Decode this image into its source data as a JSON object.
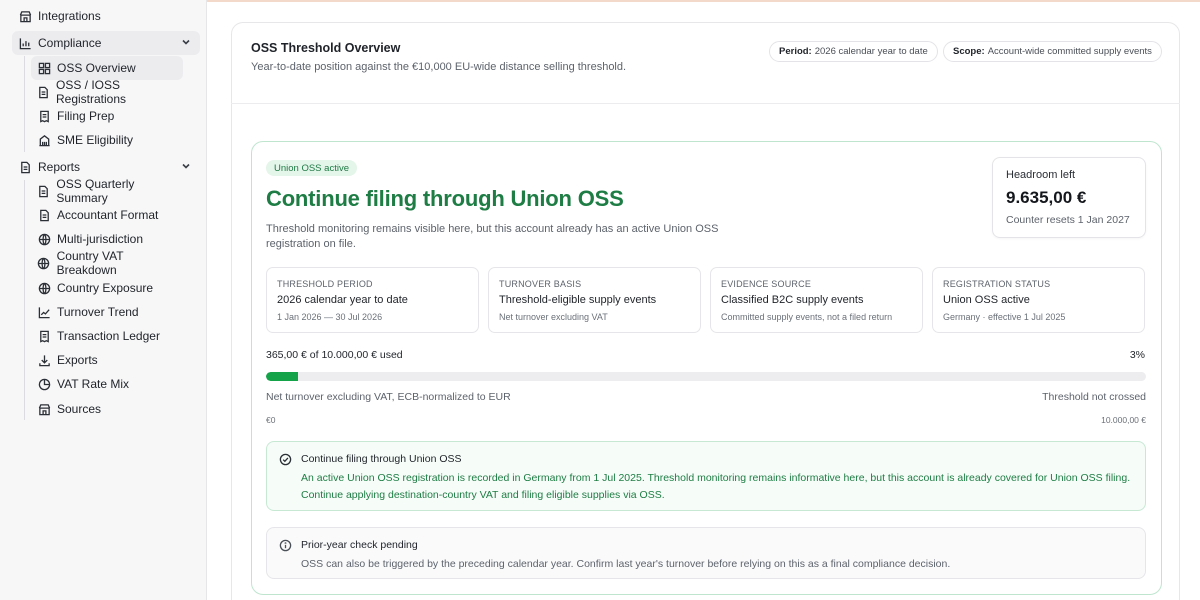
{
  "sidebar": {
    "items": [
      {
        "label": "Integrations",
        "icon": "store-icon"
      },
      {
        "label": "Compliance",
        "icon": "bar-chart-icon",
        "expanded": true
      },
      {
        "label": "OSS Overview",
        "icon": "dashboard-grid-icon",
        "active": true
      },
      {
        "label": "OSS / IOSS Registrations",
        "icon": "document-icon"
      },
      {
        "label": "Filing Prep",
        "icon": "receipt-icon"
      },
      {
        "label": "SME Eligibility",
        "icon": "building-icon"
      },
      {
        "label": "Reports",
        "icon": "document-icon",
        "expanded": true
      },
      {
        "label": "OSS Quarterly Summary",
        "icon": "document-icon"
      },
      {
        "label": "Accountant Format",
        "icon": "document-icon"
      },
      {
        "label": "Multi-jurisdiction",
        "icon": "globe-icon"
      },
      {
        "label": "Country VAT Breakdown",
        "icon": "globe-icon"
      },
      {
        "label": "Country Exposure",
        "icon": "globe-icon"
      },
      {
        "label": "Turnover Trend",
        "icon": "line-chart-icon"
      },
      {
        "label": "Transaction Ledger",
        "icon": "receipt-icon"
      },
      {
        "label": "Exports",
        "icon": "download-icon"
      },
      {
        "label": "VAT Rate Mix",
        "icon": "pie-chart-icon"
      },
      {
        "label": "Sources",
        "icon": "store-icon"
      }
    ]
  },
  "header": {
    "title": "OSS Threshold Overview",
    "subtitle": "Year-to-date position against the €10,000 EU-wide distance selling threshold.",
    "period_label": "Period:",
    "period_value": "2026 calendar year to date",
    "scope_label": "Scope:",
    "scope_value": "Account-wide committed supply events"
  },
  "status": {
    "badge": "Union OSS active",
    "headline": "Continue filing through Union OSS",
    "lead": "Threshold monitoring remains visible here, but this account already has an active Union OSS registration on file."
  },
  "headroom": {
    "label": "Headroom left",
    "value": "9.635,00 €",
    "footnote": "Counter resets 1 Jan 2027"
  },
  "stats": [
    {
      "key": "THRESHOLD PERIOD",
      "value": "2026 calendar year to date",
      "note": "1 Jan 2026 — 30 Jul 2026"
    },
    {
      "key": "TURNOVER BASIS",
      "value": "Threshold-eligible supply events",
      "note": "Net turnover excluding VAT"
    },
    {
      "key": "EVIDENCE SOURCE",
      "value": "Classified B2C supply events",
      "note": "Committed supply events, not a filed return"
    },
    {
      "key": "REGISTRATION STATUS",
      "value": "Union OSS active",
      "note": "Germany · effective 1 Jul 2025"
    }
  ],
  "progress": {
    "used_text": "365,00 € of 10.000,00 € used",
    "percent_text": "3%",
    "fraction": 0.0365,
    "basis": "Net turnover excluding VAT, ECB-normalized to EUR",
    "state": "Threshold not crossed",
    "min_label": "€0",
    "max_label": "10.000,00 €"
  },
  "alerts": {
    "ok": {
      "title": "Continue filing through Union OSS",
      "body": "An active Union OSS registration is recorded in Germany from 1 Jul 2025. Threshold monitoring remains informative here, but this account is already covered for Union OSS filing. Continue applying destination-country VAT and filing eligible supplies via OSS."
    },
    "info": {
      "title": "Prior-year check pending",
      "body": "OSS can also be triggered by the preceding calendar year. Confirm last year's turnover before relying on this as a final compliance decision."
    }
  },
  "colors": {
    "accent_green": "#1e7d44",
    "progress_green": "#14a349",
    "badge_bg": "#e4f5ea",
    "card_border": "#bfe5cf"
  }
}
